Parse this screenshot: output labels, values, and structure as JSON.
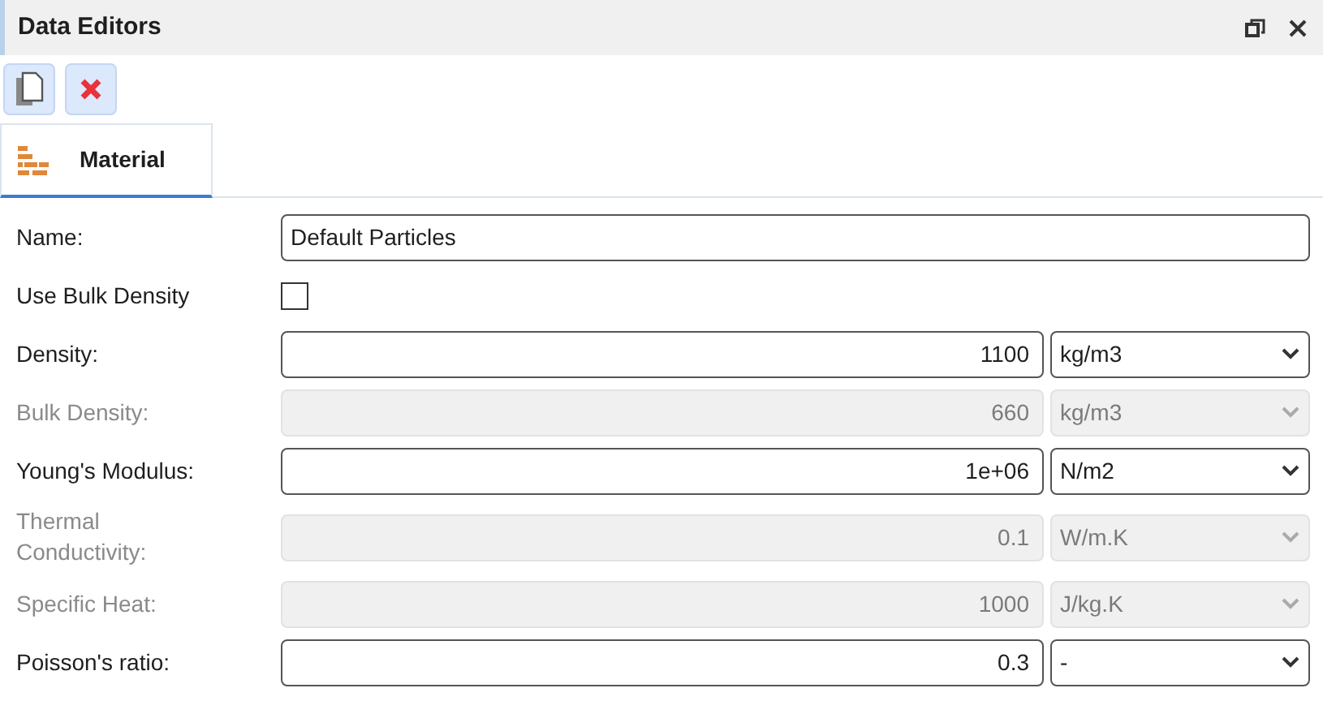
{
  "window": {
    "title": "Data Editors"
  },
  "toolbar": [
    {
      "kind": "copy"
    },
    {
      "kind": "delete"
    }
  ],
  "tabs": [
    {
      "label": "Material",
      "selected": true
    }
  ],
  "fields": [
    {
      "kind": "text",
      "label": "Name:",
      "value": "Default Particles",
      "disabled": false
    },
    {
      "kind": "checkbox",
      "label": "Use Bulk Density",
      "checked": false,
      "disabled": false
    },
    {
      "kind": "quantity",
      "label": "Density:",
      "value": "1100",
      "unit": "kg/m3",
      "disabled": false
    },
    {
      "kind": "quantity",
      "label": "Bulk Density:",
      "value": "660",
      "unit": "kg/m3",
      "disabled": true
    },
    {
      "kind": "quantity",
      "label": "Young's Modulus:",
      "value": "1e+06",
      "unit": "N/m2",
      "disabled": false
    },
    {
      "kind": "quantity",
      "label": "Thermal Conductivity:",
      "value": "0.1",
      "unit": "W/m.K",
      "disabled": true
    },
    {
      "kind": "quantity",
      "label": "Specific Heat:",
      "value": "1000",
      "unit": "J/kg.K",
      "disabled": true
    },
    {
      "kind": "quantity",
      "label": "Poisson's ratio:",
      "value": "0.3",
      "unit": "-",
      "disabled": false
    }
  ]
}
